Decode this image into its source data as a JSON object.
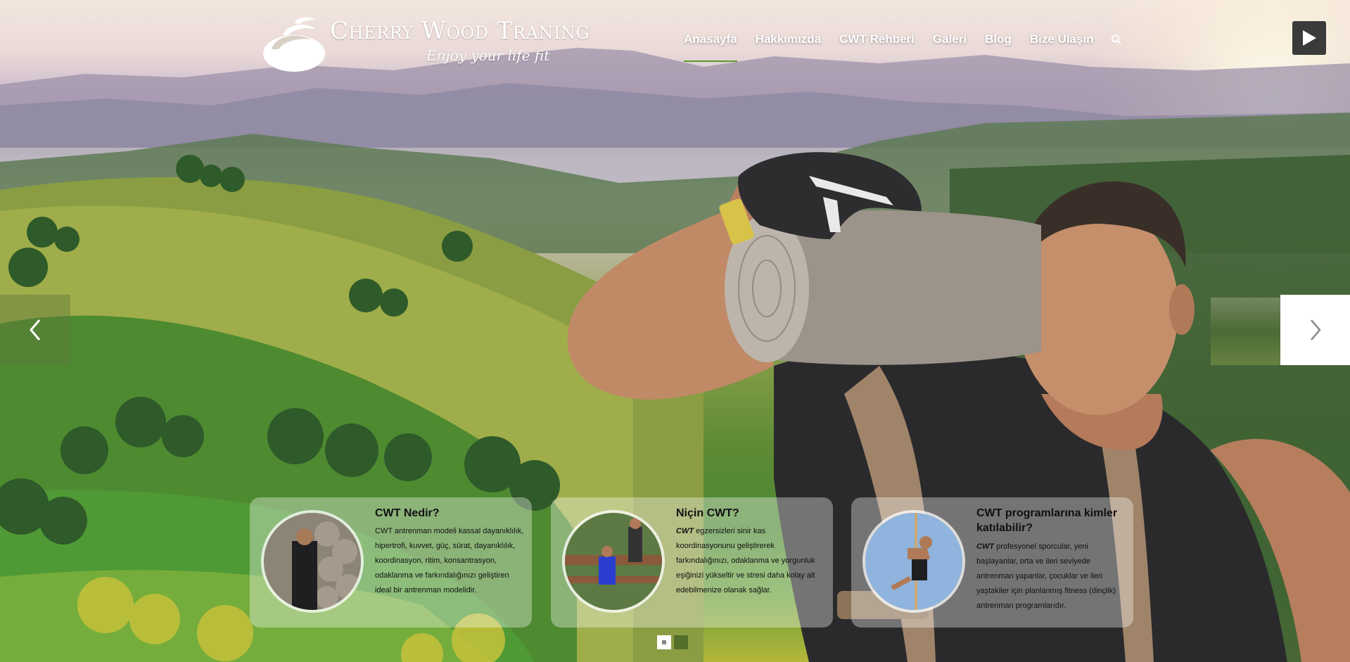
{
  "brand": {
    "title": "Cherry Wood Traning",
    "tagline": "Enjoy your life fit",
    "icon": "swirl-logo-icon"
  },
  "nav": {
    "items": [
      {
        "label": "Anasayfa",
        "active": true
      },
      {
        "label": "Hakkımızda",
        "active": false
      },
      {
        "label": "CWT Rehberi",
        "active": false
      },
      {
        "label": "Galeri",
        "active": false
      },
      {
        "label": "Blog",
        "active": false
      },
      {
        "label": "Bize Ulaşın",
        "active": false
      }
    ],
    "search_icon": "search-icon",
    "accent_color": "#5a9a2c"
  },
  "slider": {
    "prev_icon": "chevron-left-icon",
    "next_icon": "chevron-right-icon",
    "play_icon": "play-icon",
    "pages": 2,
    "current_page": 1
  },
  "cards": [
    {
      "title": "CWT Nedir?",
      "text": "CWT antrenman modeli kassal dayanıklılık, hipertrofi, kuvvet, güç, sürat, dayanıklılık, koordinasyon, ritim, konsantrasyon, odaklanma ve farkındalığınızı geliştiren ideal bir antrenman modelidir."
    },
    {
      "title": "Niçin CWT?",
      "lead": "CWT",
      "text": " egzersizleri sinir kas koordinasyonunu geliştirerek farkındalığınızı, odaklanma ve yorgunluk eşiğinizi yükseltir ve stresi daha kolay alt edebilmenize olanak sağlar."
    },
    {
      "title": "CWT programlarına kimler katılabilir?",
      "lead": "CWT",
      "text": " profesyonel sporcular, yeni başlayanlar, orta ve ileri seviyede antrenman yapanlar, çocuklar ve ileri yaştakiler için planlanmış fitness (dinçlik) antrenman programlarıdır."
    }
  ]
}
